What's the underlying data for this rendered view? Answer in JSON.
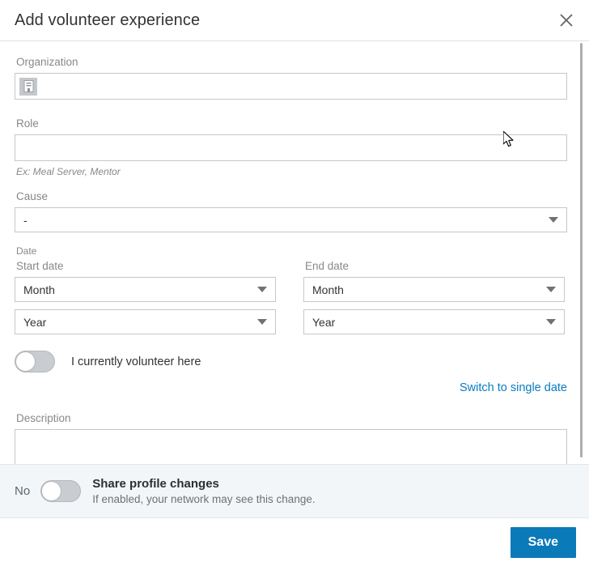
{
  "header": {
    "title": "Add volunteer experience",
    "close_icon": "close-icon"
  },
  "form": {
    "organization": {
      "label": "Organization",
      "value": "",
      "placeholder": "",
      "icon": "company-building-icon"
    },
    "role": {
      "label": "Role",
      "value": "",
      "placeholder": "",
      "hint": "Ex: Meal Server, Mentor"
    },
    "cause": {
      "label": "Cause",
      "value": "-",
      "caret_icon": "chevron-down-icon"
    },
    "date": {
      "section_label": "Date",
      "start": {
        "label": "Start date",
        "month_value": "Month",
        "year_value": "Year"
      },
      "end": {
        "label": "End date",
        "month_value": "Month",
        "year_value": "Year"
      }
    },
    "currently_volunteer": {
      "label": "I currently volunteer here",
      "state": "off"
    },
    "switch_date_link": "Switch to single date",
    "description": {
      "label": "Description",
      "value": "",
      "placeholder": ""
    }
  },
  "share_bar": {
    "state_label": "No",
    "title": "Share profile changes",
    "subtitle": "If enabled, your network may see this change.",
    "state": "off"
  },
  "footer": {
    "save_label": "Save"
  },
  "colors": {
    "accent": "#0a7ab8",
    "link": "#0b7bc1",
    "share_bar_bg": "#f3f6f8",
    "border": "#c7c7c7"
  }
}
